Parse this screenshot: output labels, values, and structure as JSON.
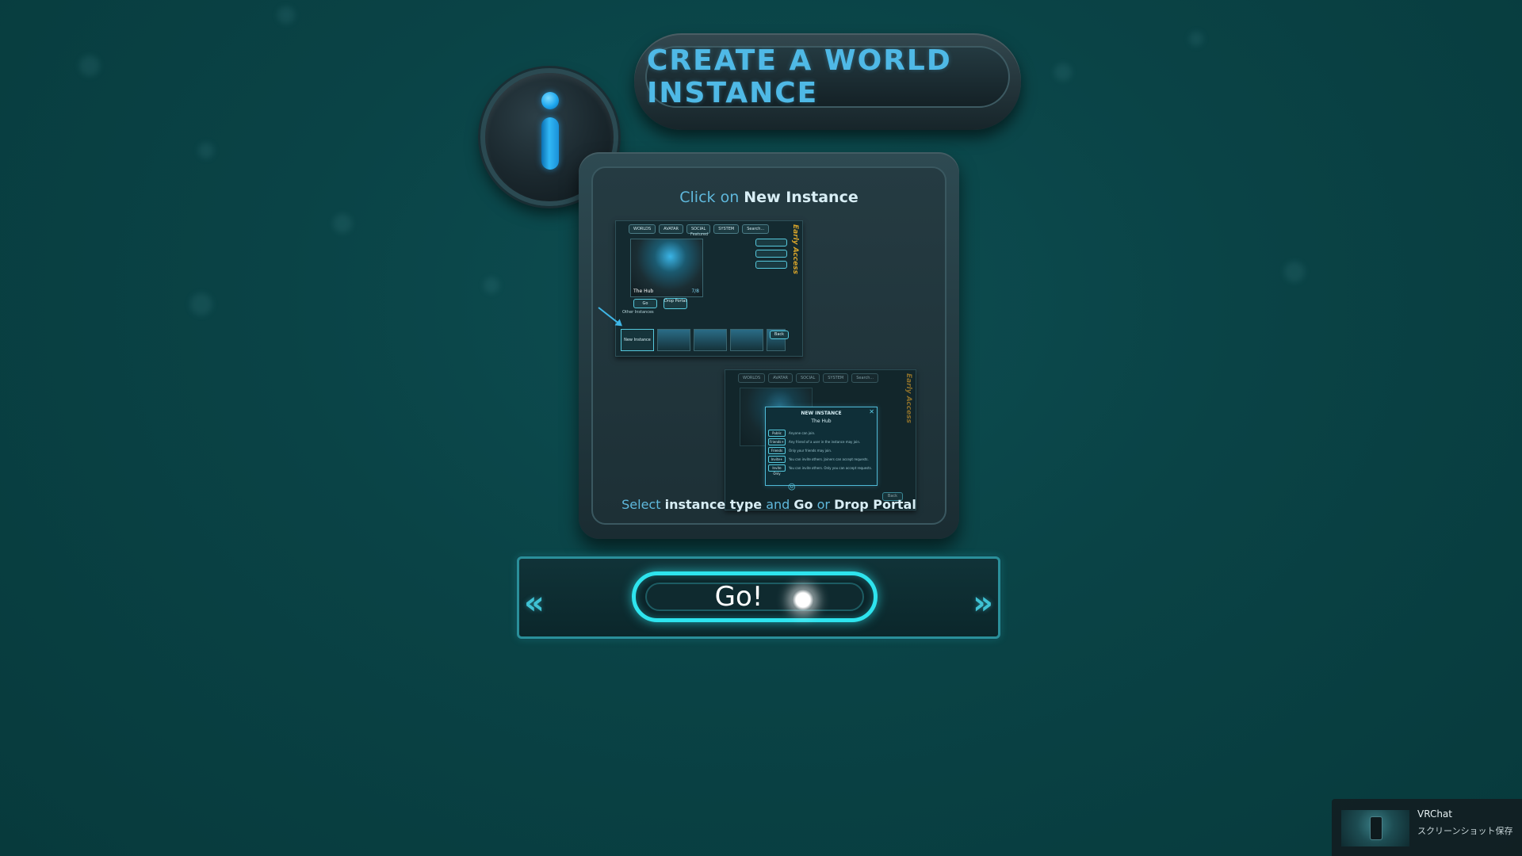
{
  "title": "CREATE A WORLD INSTANCE",
  "panel": {
    "heading_pre": "Click on",
    "heading_strong": "New Instance",
    "footer_1": "Select",
    "footer_2": "instance type",
    "footer_3": "and",
    "footer_4": "Go",
    "footer_5": "or",
    "footer_6": "Drop Portal"
  },
  "shot1": {
    "tabs": [
      "WORLDS",
      "AVATAR",
      "SOCIAL",
      "SYSTEM",
      "Search..."
    ],
    "featured": "Featured",
    "world_name": "The Hub",
    "player_count": "7/8",
    "go_label": "Go",
    "drop_portal_label": "Drop Portal",
    "other_instances": "Other Instances",
    "new_instance_label": "New Instance",
    "back_label": "Back",
    "early_access": "Early Access"
  },
  "shot2": {
    "dialog_title": "NEW INSTANCE",
    "dialog_world": "The Hub",
    "options": [
      {
        "label": "Public",
        "desc": "Anyone can join."
      },
      {
        "label": "Friends+",
        "desc": "Any friend of a user in the instance may join."
      },
      {
        "label": "Friends",
        "desc": "Only your friends may join."
      },
      {
        "label": "Invite+",
        "desc": "You can invite others. Joiners can accept requests."
      },
      {
        "label": "Invite Only",
        "desc": "You can invite others. Only you can accept requests."
      }
    ],
    "early_access": "Early Access",
    "back_label": "Back"
  },
  "go_button": {
    "label": "Go!",
    "left_chevron": "«",
    "right_chevron": "»"
  },
  "notification": {
    "app": "VRChat",
    "message": "スクリーンショット保存"
  },
  "colors": {
    "background": "#0a4346",
    "accent_cyan": "#2ee4ee",
    "title_blue": "#4fb9e6",
    "early_access_gold": "#d4a22a"
  }
}
